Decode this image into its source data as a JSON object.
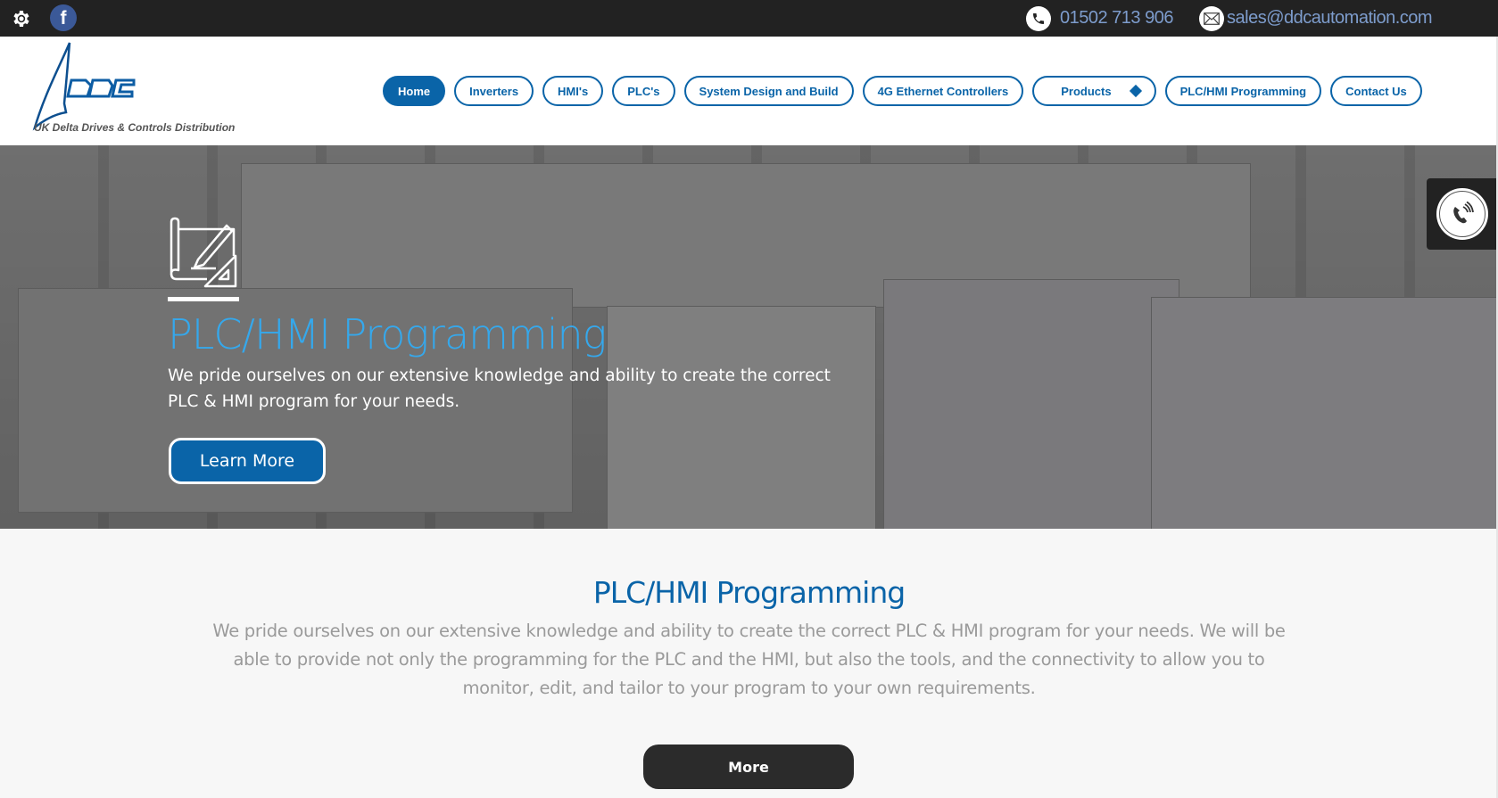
{
  "topbar": {
    "settings_icon": "gear-icon",
    "social_icon": "facebook-icon",
    "facebook_glyph": "f",
    "phone": "01502 713 906",
    "email": "sales@ddcautomation.com"
  },
  "header": {
    "logo_text": "DDC",
    "logo_tagline": "UK Delta Drives & Controls Distribution"
  },
  "nav": {
    "items": [
      {
        "label": "Home",
        "active": true
      },
      {
        "label": "Inverters"
      },
      {
        "label": "HMI's"
      },
      {
        "label": "PLC's"
      },
      {
        "label": "System Design and Build"
      },
      {
        "label": "4G Ethernet Controllers"
      },
      {
        "label": "Products",
        "has_dropdown": true
      },
      {
        "label": "PLC/HMI Programming"
      },
      {
        "label": "Contact Us"
      }
    ]
  },
  "hero": {
    "icon": "blueprint-pencil-icon",
    "title": "PLC/HMI Programming",
    "text": "We pride ourselves on our extensive knowledge and ability to create the correct PLC & HMI program for your needs.",
    "button_label": "Learn More"
  },
  "call_widget": {
    "icon": "phone-ringing-icon"
  },
  "section": {
    "title": "PLC/HMI Programming",
    "text": "We pride ourselves on our extensive knowledge and ability to create the correct PLC & HMI program for your needs. We will be able to provide not only the programming for the PLC and the HMI, but also the tools, and the connectivity to allow you to monitor, edit, and tailor to your program to your own requirements.",
    "button_label": "More"
  },
  "colors": {
    "brand_blue": "#0a64a8",
    "hero_title": "#35a8ec",
    "topbar": "#222222",
    "contact_text": "#7d9ccc",
    "more_button": "#2b2b2b"
  }
}
